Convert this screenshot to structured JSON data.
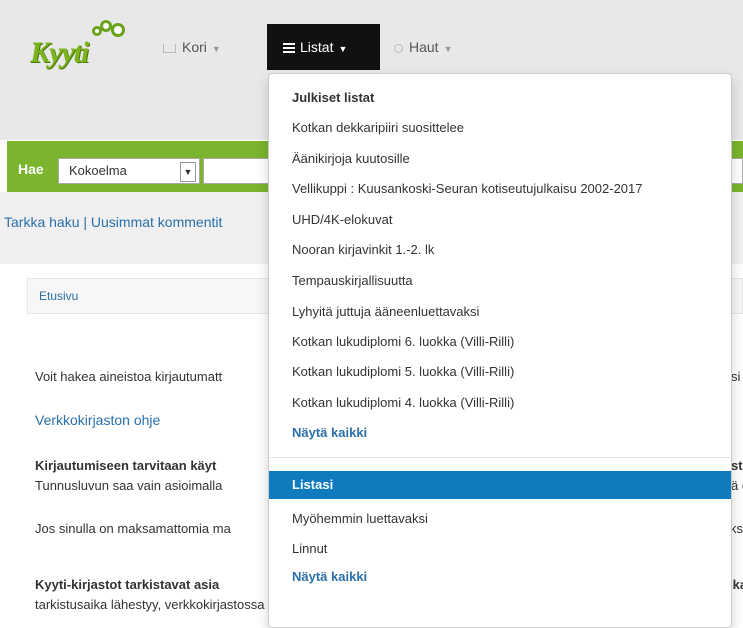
{
  "brand": {
    "logo_text": "Kyyti"
  },
  "nav": {
    "kori": "Kori",
    "listat": "Listat",
    "haut": "Haut"
  },
  "search": {
    "label": "Hae",
    "scope_selected": "Kokoelma",
    "query": ""
  },
  "links": "Tarkka haku | Uusimmat kommentit",
  "breadcrumb": "Etusivu",
  "body": {
    "p1": "Voit hakea aineistoa kirjautumatt",
    "p1_end": "si",
    "help_link": "Verkkokirjaston ohje",
    "p3_bold": "Kirjautumiseen tarvitaan käyt",
    "p3_bold_end": "st",
    "p3": "Tunnusluvun saa vain asioimalla",
    "p3_end": "ä e",
    "p4": "Jos sinulla on maksamattomia ma",
    "p4_end": "ksi",
    "p5_bold": "Kyyti-kirjastot tarkistavat asia",
    "p5_bold_end": "ika",
    "p5": "tarkistusaika lähestyy, verkkokirjastossa näkyy kirjautumisen jälkeen huomautus, jossa kehotetaa"
  },
  "dropdown": {
    "public_header": "Julkiset listat",
    "public_lists": [
      "Kotkan dekkaripiiri suosittelee",
      "Äänikirjoja kuutosille",
      "Vellikuppi : Kuusankoski-Seuran kotiseutujulkaisu 2002-2017",
      "UHD/4K-elokuvat",
      "Nooran kirjavinkit 1.-2. lk",
      "Tempauskirjallisuutta",
      "Lyhyitä juttuja ääneenluettavaksi",
      "Kotkan lukudiplomi 6. luokka (Villi-Rilli)",
      "Kotkan lukudiplomi 5. luokka (Villi-Rilli)",
      "Kotkan lukudiplomi 4. luokka (Villi-Rilli)"
    ],
    "show_all_1": "Näytä kaikki",
    "my_header": "Listasi",
    "my_lists": [
      "Myöhemmin luettavaksi",
      "Linnut"
    ],
    "show_all_2": "Näytä kaikki"
  }
}
